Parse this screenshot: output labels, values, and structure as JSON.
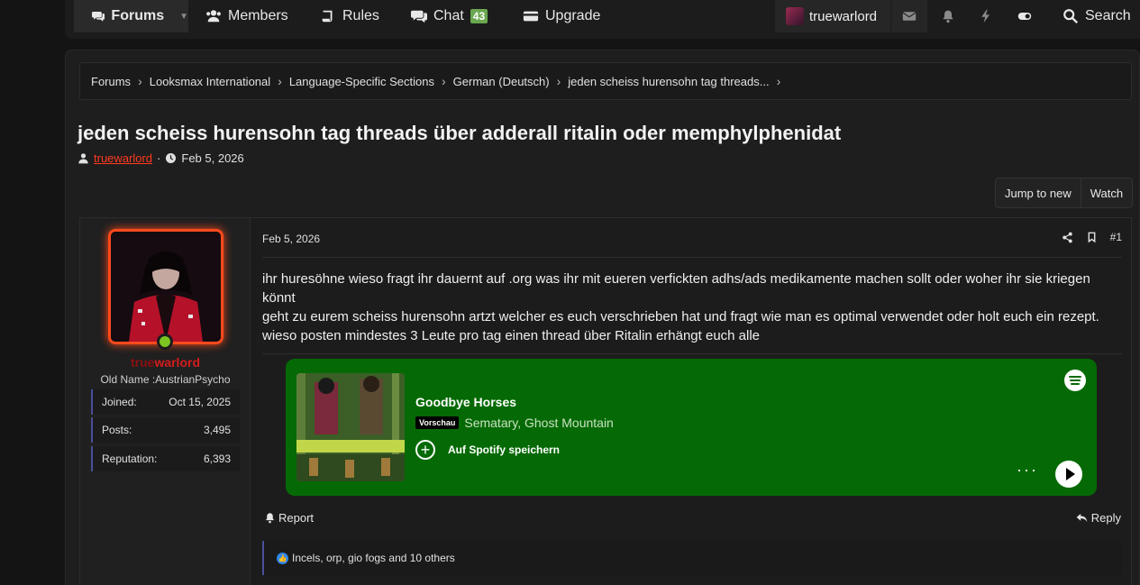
{
  "nav": {
    "forums": "Forums",
    "members": "Members",
    "rules": "Rules",
    "chat": "Chat",
    "chat_badge": "43",
    "upgrade": "Upgrade",
    "user": "truewarlord",
    "search": "Search"
  },
  "breadcrumb": {
    "items": [
      "Forums",
      "Looksmax International",
      "Language-Specific Sections",
      "German (Deutsch)",
      "jeden scheiss hurensohn tag threads..."
    ]
  },
  "thread": {
    "title": "jeden scheiss hurensohn tag threads über adderall ritalin oder memphylphenidat",
    "author": "truewarlord",
    "separator": "·",
    "date": "Feb 5, 2026",
    "jump_label": "Jump to new",
    "watch_label": "Watch"
  },
  "user": {
    "name_part1": "true",
    "name_part2": "warlord",
    "old_name": "Old Name :AustrianPsycho",
    "stats": [
      {
        "label": "Joined:",
        "value": "Oct 15, 2025"
      },
      {
        "label": "Posts:",
        "value": "3,495"
      },
      {
        "label": "Reputation:",
        "value": "6,393"
      }
    ]
  },
  "post": {
    "date": "Feb 5, 2026",
    "number": "#1",
    "lines": [
      "ihr huresöhne wieso fragt ihr dauernt auf .org was ihr mit eueren verfickten adhs/ads medikamente machen sollt oder woher ihr sie kriegen könnt",
      "geht zu eurem scheiss hurensohn artzt welcher es euch verschrieben hat und fragt wie man es optimal verwendet oder holt euch ein rezept.",
      "wieso posten mindestes 3 Leute pro tag einen thread über Ritalin erhängt euch alle"
    ],
    "report_label": "Report",
    "reply_label": "Reply",
    "reactions_text": "Incels, orp, gio fogs and 10 others"
  },
  "spotify": {
    "song": "Goodbye Horses",
    "preview_badge": "Vorschau",
    "artists": "Sematary, Ghost Mountain",
    "save_label": "Auf Spotify speichern",
    "bg_color": "#056a05"
  },
  "colors": {
    "author_red": "#ff3b1f",
    "username_red": "#d61c1c",
    "online_green": "#7cc522",
    "accent_blue": "#4a4f9a",
    "chat_badge_green": "#6aa84f"
  }
}
